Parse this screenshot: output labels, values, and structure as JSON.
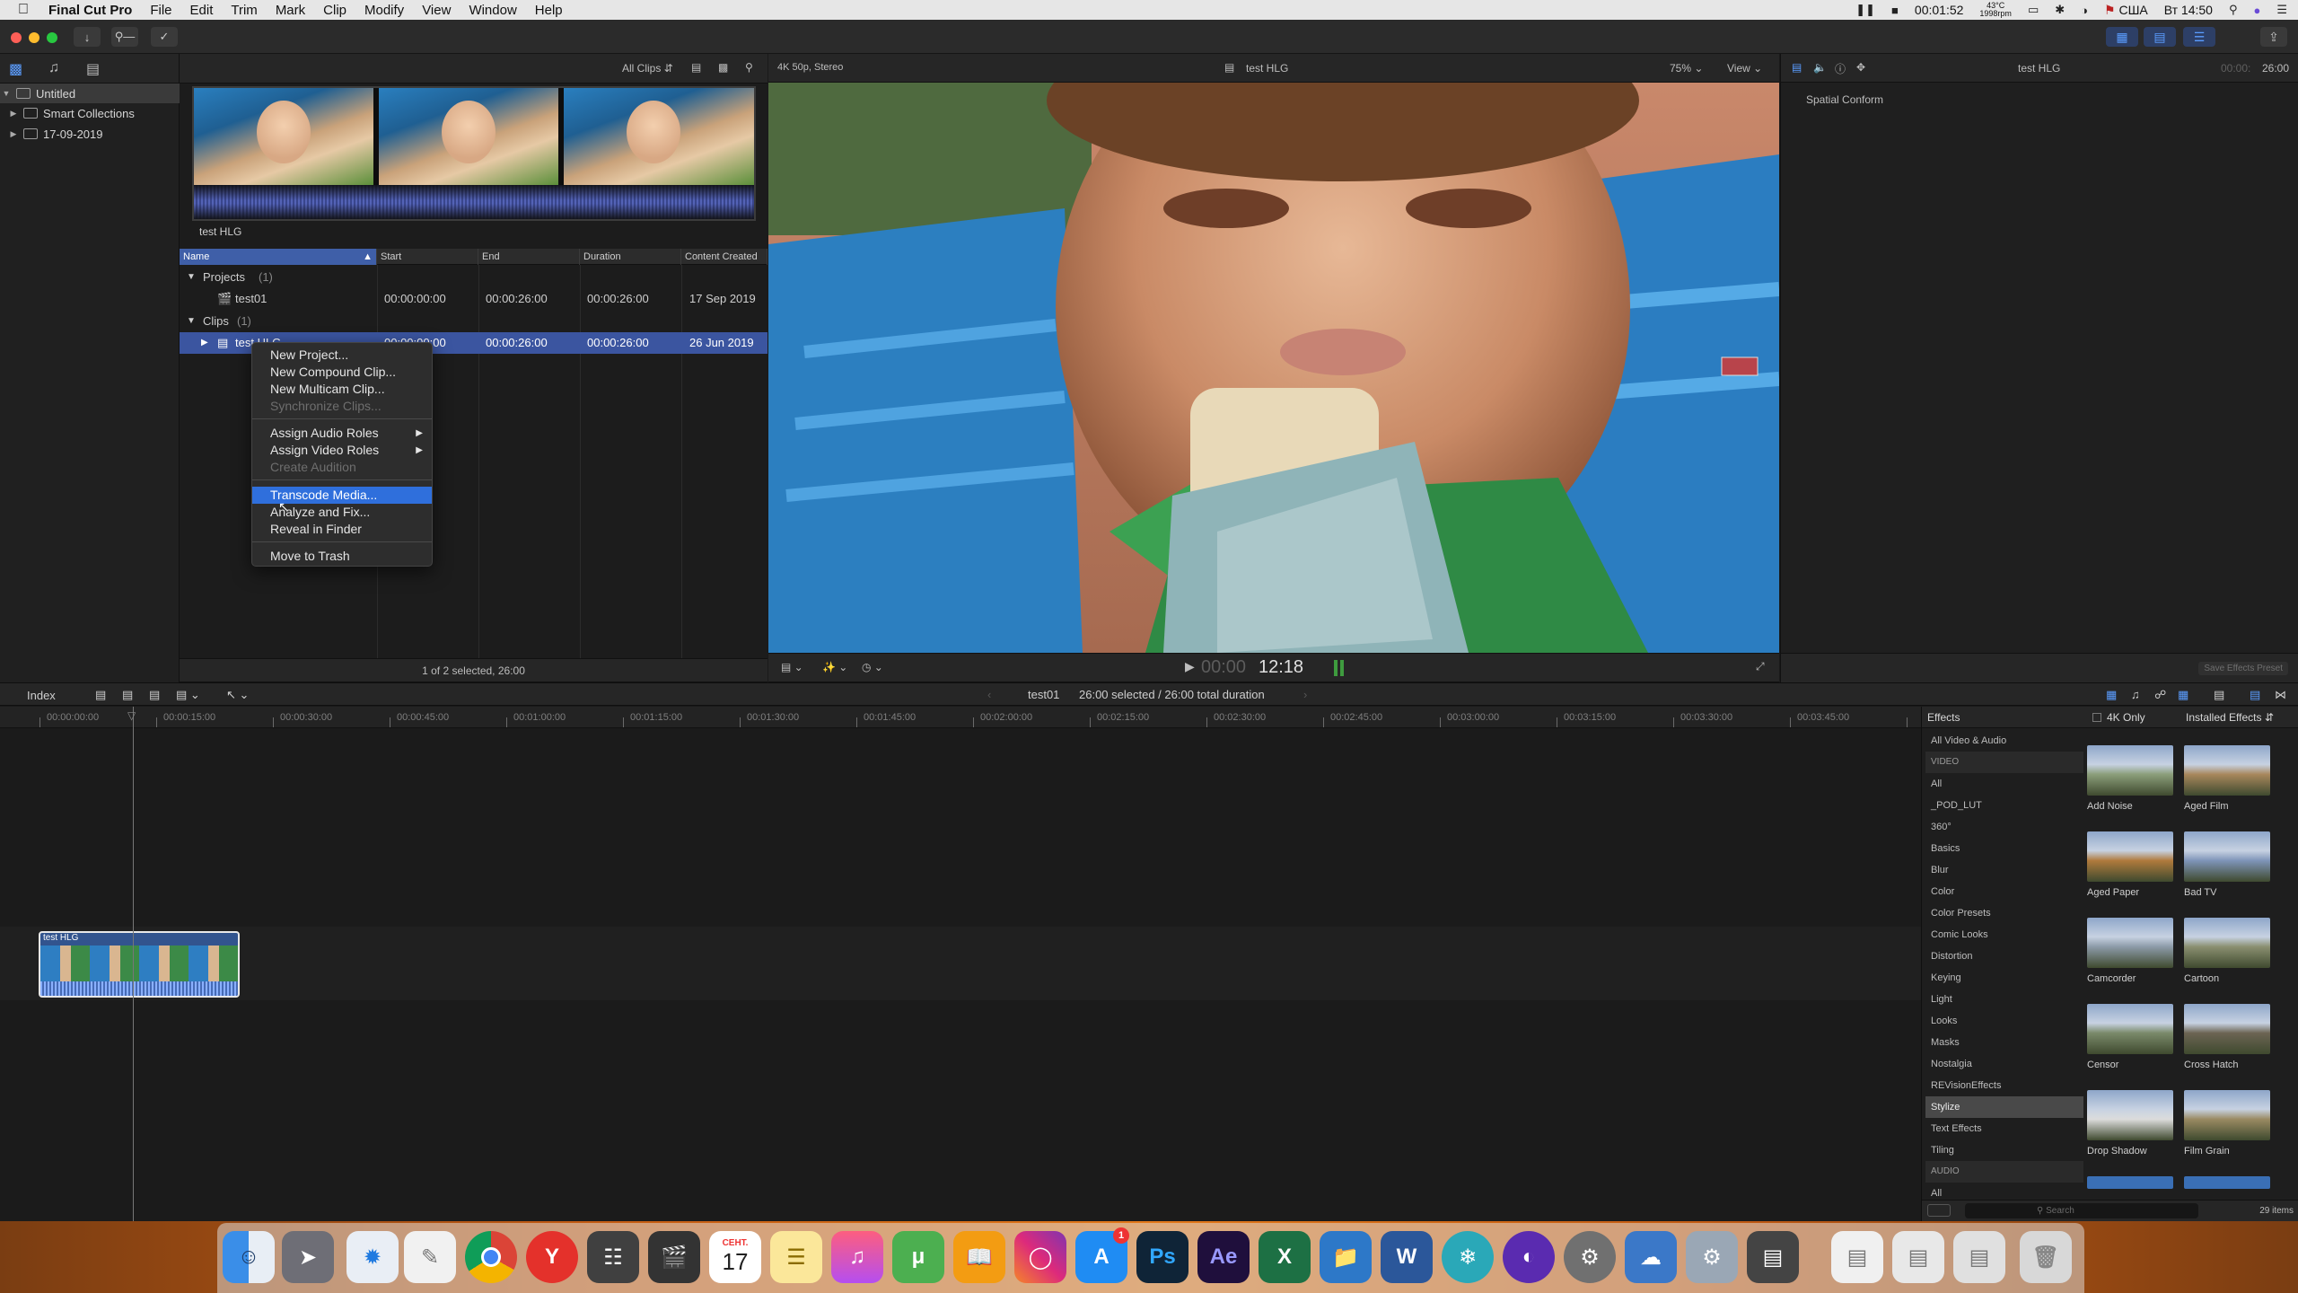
{
  "menubar": {
    "app_name": "Final Cut Pro",
    "menus": [
      "File",
      "Edit",
      "Trim",
      "Mark",
      "Clip",
      "Modify",
      "View",
      "Window",
      "Help"
    ],
    "timer": "00:01:52",
    "cpu_temp": "43°C",
    "fan_rpm": "1998rpm",
    "input_source": "США",
    "clock": "Вт 14:50"
  },
  "sidebar": {
    "items": [
      {
        "label": "Untitled"
      },
      {
        "label": "Smart Collections"
      },
      {
        "label": "17-09-2019"
      }
    ]
  },
  "browser": {
    "filter_label": "All Clips",
    "filmstrip_name": "test HLG",
    "columns": [
      "Name",
      "Start",
      "End",
      "Duration",
      "Content Created"
    ],
    "groups": [
      {
        "label": "Projects",
        "count": "(1)"
      },
      {
        "label": "Clips",
        "count": "(1)"
      }
    ],
    "rows": [
      {
        "name": "test01",
        "start": "00:00:00:00",
        "end": "00:00:26:00",
        "duration": "00:00:26:00",
        "created": "17 Sep 2019"
      },
      {
        "name": "test HLG",
        "start": "00:00:00:00",
        "end": "00:00:26:00",
        "duration": "00:00:26:00",
        "created": "26 Jun 2019"
      }
    ],
    "status": "1 of 2 selected, 26:00"
  },
  "context_menu": {
    "items": [
      {
        "label": "New Project...",
        "enabled": true
      },
      {
        "label": "New Compound Clip...",
        "enabled": true
      },
      {
        "label": "New Multicam Clip...",
        "enabled": true
      },
      {
        "label": "Synchronize Clips...",
        "enabled": false
      },
      {
        "label": "Assign Audio Roles",
        "enabled": true
      },
      {
        "label": "Assign Video Roles",
        "enabled": true
      },
      {
        "label": "Create Audition",
        "enabled": false
      },
      {
        "label": "Transcode Media...",
        "enabled": true,
        "highlighted": true
      },
      {
        "label": "Analyze and Fix...",
        "enabled": true
      },
      {
        "label": "Reveal in Finder",
        "enabled": true
      },
      {
        "label": "Move to Trash",
        "enabled": true
      }
    ]
  },
  "viewer": {
    "format": "4K 50p, Stereo",
    "clip_name": "test HLG",
    "zoom": "75%",
    "view_label": "View",
    "timecode_dim": "00:00",
    "timecode": "12:18"
  },
  "inspector": {
    "clip_name": "test HLG",
    "duration": "26:00",
    "section": "Spatial Conform",
    "save_preset": "Save Effects Preset"
  },
  "timeline": {
    "index_label": "Index",
    "project_name": "test01",
    "selection_info": "26:00 selected / 26:00 total duration",
    "ruler": [
      "00:00:00:00",
      "00:00:15:00",
      "00:00:30:00",
      "00:00:45:00",
      "00:01:00:00",
      "00:01:15:00",
      "00:01:30:00",
      "00:01:45:00",
      "00:02:00:00",
      "00:02:15:00",
      "00:02:30:00",
      "00:02:45:00",
      "00:03:00:00",
      "00:03:15:00",
      "00:03:30:00",
      "00:03:45:00"
    ],
    "clip_name": "test HLG"
  },
  "effects": {
    "title": "Effects",
    "filter": "4K Only",
    "installed": "Installed Effects",
    "categories": [
      {
        "label": "All Video & Audio",
        "type": "item"
      },
      {
        "label": "VIDEO",
        "type": "head"
      },
      {
        "label": "All",
        "type": "item"
      },
      {
        "label": "_POD_LUT",
        "type": "item"
      },
      {
        "label": "360°",
        "type": "item"
      },
      {
        "label": "Basics",
        "type": "item"
      },
      {
        "label": "Blur",
        "type": "item"
      },
      {
        "label": "Color",
        "type": "item"
      },
      {
        "label": "Color Presets",
        "type": "item"
      },
      {
        "label": "Comic Looks",
        "type": "item"
      },
      {
        "label": "Distortion",
        "type": "item"
      },
      {
        "label": "Keying",
        "type": "item"
      },
      {
        "label": "Light",
        "type": "item"
      },
      {
        "label": "Looks",
        "type": "item"
      },
      {
        "label": "Masks",
        "type": "item"
      },
      {
        "label": "Nostalgia",
        "type": "item"
      },
      {
        "label": "REVisionEffects",
        "type": "item"
      },
      {
        "label": "Stylize",
        "type": "sel"
      },
      {
        "label": "Text Effects",
        "type": "item"
      },
      {
        "label": "Tiling",
        "type": "item"
      },
      {
        "label": "AUDIO",
        "type": "head"
      },
      {
        "label": "All",
        "type": "item"
      }
    ],
    "items": [
      "Add Noise",
      "Aged Film",
      "Aged Paper",
      "Bad TV",
      "Camcorder",
      "Cartoon",
      "Censor",
      "Cross Hatch",
      "Drop Shadow",
      "Film Grain"
    ],
    "search_placeholder": "Search",
    "count": "29 items"
  },
  "dock": {
    "calendar_month": "СЕНТ.",
    "calendar_day": "17",
    "appstore_badge": "1",
    "photoshop": "Ps",
    "after_effects": "Ae",
    "excel": "X",
    "word": "W",
    "yandex": "Y"
  }
}
